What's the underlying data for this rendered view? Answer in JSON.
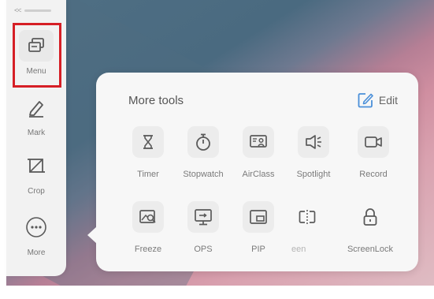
{
  "sidebar": {
    "items": [
      {
        "label": "Menu",
        "icon": "windows-icon"
      },
      {
        "label": "Mark",
        "icon": "pen-icon"
      },
      {
        "label": "Crop",
        "icon": "crop-icon"
      },
      {
        "label": "More",
        "icon": "more-icon"
      }
    ]
  },
  "panel": {
    "title": "More tools",
    "edit_label": "Edit",
    "tools": [
      {
        "label": "Timer",
        "icon": "hourglass-icon"
      },
      {
        "label": "Stopwatch",
        "icon": "stopwatch-icon"
      },
      {
        "label": "AirClass",
        "icon": "airclass-icon"
      },
      {
        "label": "Spotlight",
        "icon": "spotlight-icon"
      },
      {
        "label": "Record",
        "icon": "record-icon"
      },
      {
        "label": "Freeze",
        "icon": "freeze-icon"
      },
      {
        "label": "OPS",
        "icon": "ops-icon"
      },
      {
        "label": "PIP",
        "icon": "pip-icon"
      },
      {
        "label": "een",
        "icon": "split-screen-icon"
      },
      {
        "label": "ScreenLock",
        "icon": "lock-icon"
      }
    ]
  },
  "colors": {
    "highlight": "#d61f26",
    "icon": "#5a5a5a",
    "edit_accent": "#4a8fd9"
  }
}
